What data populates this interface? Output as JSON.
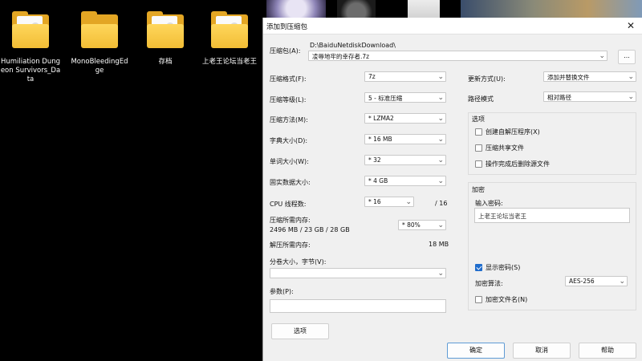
{
  "desktop": {
    "icons": [
      {
        "label": "Humiliation Dungeon Survivors_Data"
      },
      {
        "label": "MonoBleedingEdge"
      },
      {
        "label": "存档"
      },
      {
        "label": "上老王论坛当老王"
      }
    ]
  },
  "dialog": {
    "title": "添加到压缩包",
    "archive": {
      "label": "压缩包(A):",
      "path": "D:\\BaiduNetdiskDownload\\",
      "name": "凌辱地牢的幸存者.7z",
      "browse_label": "..."
    },
    "format": {
      "label": "压缩格式(F):",
      "value": "7z"
    },
    "level": {
      "label": "压缩等级(L):",
      "value": "5 - 标准压缩"
    },
    "method": {
      "label": "压缩方法(M):",
      "value": "* LZMA2"
    },
    "dict": {
      "label": "字典大小(D):",
      "value": "* 16 MB"
    },
    "word": {
      "label": "单词大小(W):",
      "value": "* 32"
    },
    "solid": {
      "label": "固实数据大小:",
      "value": "* 4 GB"
    },
    "threads": {
      "label": "CPU 线程数:",
      "value": "* 16",
      "total": "/ 16"
    },
    "mem_compress": {
      "label": "压缩所需内存:",
      "detail": "2496 MB / 23 GB / 28 GB",
      "value": "* 80%"
    },
    "mem_decompress": {
      "label": "解压所需内存:",
      "value": "18 MB"
    },
    "split": {
      "label": "分卷大小，字节(V):",
      "value": ""
    },
    "params": {
      "label": "参数(P):",
      "value": ""
    },
    "options_button": "选项",
    "update_mode": {
      "label": "更新方式(U):",
      "value": "添加并替换文件"
    },
    "path_mode": {
      "label": "路径模式",
      "value": "相对路径"
    },
    "options": {
      "title": "选项",
      "items": [
        {
          "label": "创建自解压程序(X)",
          "checked": false
        },
        {
          "label": "压缩共享文件",
          "checked": false
        },
        {
          "label": "操作完成后删除源文件",
          "checked": false
        }
      ]
    },
    "encryption": {
      "title": "加密",
      "password_label": "输入密码:",
      "password_value": "上老王论坛当老王",
      "show_password": {
        "label": "显示密码(S)",
        "checked": true
      },
      "method_label": "加密算法:",
      "method_value": "AES-256",
      "encrypt_names": {
        "label": "加密文件名(N)",
        "checked": false
      }
    },
    "buttons": {
      "ok": "确定",
      "cancel": "取消",
      "help": "帮助"
    }
  },
  "colors": {
    "accent": "#1f6ccc",
    "folder": "#f2bd35"
  }
}
